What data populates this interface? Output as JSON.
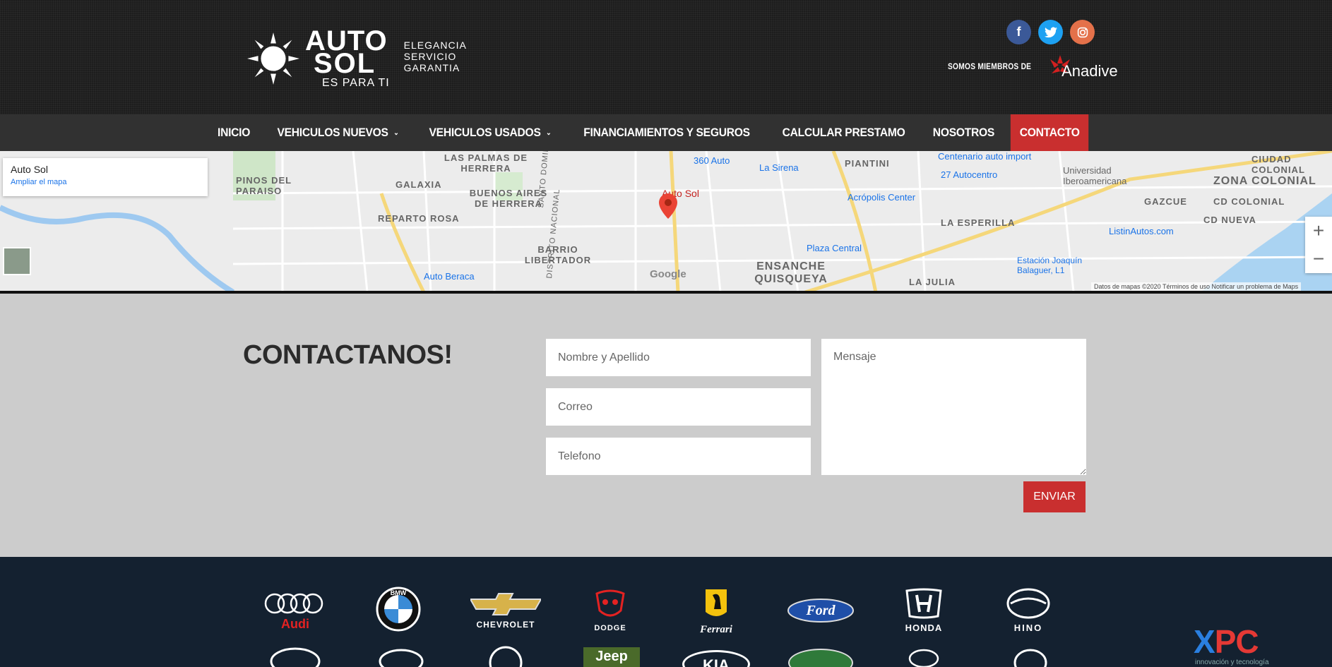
{
  "header": {
    "brand_line1": "AUTO",
    "brand_line2": "SOL",
    "brand_line3": "ES PARA TI",
    "tagline": [
      "ELEGANCIA",
      "SERVICIO",
      "GARANTIA"
    ],
    "social_icons": [
      "facebook-icon",
      "twitter-icon",
      "instagram-icon"
    ],
    "members_text": "SOMOS MIEMBROS DE",
    "members_brand": "Anadive"
  },
  "nav": {
    "items": [
      {
        "label": "INICIO",
        "dropdown": false
      },
      {
        "label": "VEHICULOS NUEVOS",
        "dropdown": true
      },
      {
        "label": "VEHICULOS USADOS",
        "dropdown": true
      },
      {
        "label": "FINANCIAMIENTOS Y SEGUROS",
        "dropdown": false
      },
      {
        "label": "CALCULAR PRESTAMO",
        "dropdown": false
      },
      {
        "label": "NOSOTROS",
        "dropdown": false
      },
      {
        "label": "CONTACTO",
        "dropdown": false,
        "active": true
      }
    ],
    "active_color": "#c92f2f"
  },
  "map": {
    "place_title": "Auto Sol",
    "enlarge_link": "Ampliar el mapa",
    "pin_label": "Auto Sol",
    "labels": [
      "BUENOS AIRES DE HERRERA",
      "GALAXIA",
      "REPARTO ROSA",
      "BARRIO LIBERTADOR",
      "ENSANCHE QUISQUEYA",
      "ZONA COLONIAL",
      "CD COLONIAL",
      "LA ESPERILLA",
      "PIANTINI",
      "LAS PALMAS DE HERRERA",
      "PINOS DEL PARAISO",
      "CIUDAD COLONIAL",
      "GAZCUE",
      "CD NUEVA",
      "LA JULIA",
      "360 Auto",
      "La Sirena",
      "27 Autocentro",
      "Acrópolis Center",
      "Plaza Central",
      "ListinAutos.com",
      "Auto Beraca",
      "Centenario auto import",
      "Universidad Iberoamericana",
      "Estación Joaquín Balaguer, L1",
      "SANTO DOMINGO",
      "DISTRITO NACIONAL"
    ],
    "footer": "Datos de mapas ©2020   Términos de uso   Notificar un problema de Maps",
    "google": "Google"
  },
  "contact": {
    "title": "CONTACTANOS!",
    "name_placeholder": "Nombre y Apellido",
    "email_placeholder": "Correo",
    "phone_placeholder": "Telefono",
    "message_placeholder": "Mensaje",
    "submit_label": "ENVIAR"
  },
  "footer": {
    "brands": [
      "Audi",
      "BMW",
      "CHEVROLET",
      "DODGE",
      "Ferrari",
      "Ford",
      "HONDA",
      "HINO",
      "Jeep",
      "KIA"
    ],
    "xpc_brand": "XPC",
    "xpc_sub": "innovación y tecnología"
  }
}
